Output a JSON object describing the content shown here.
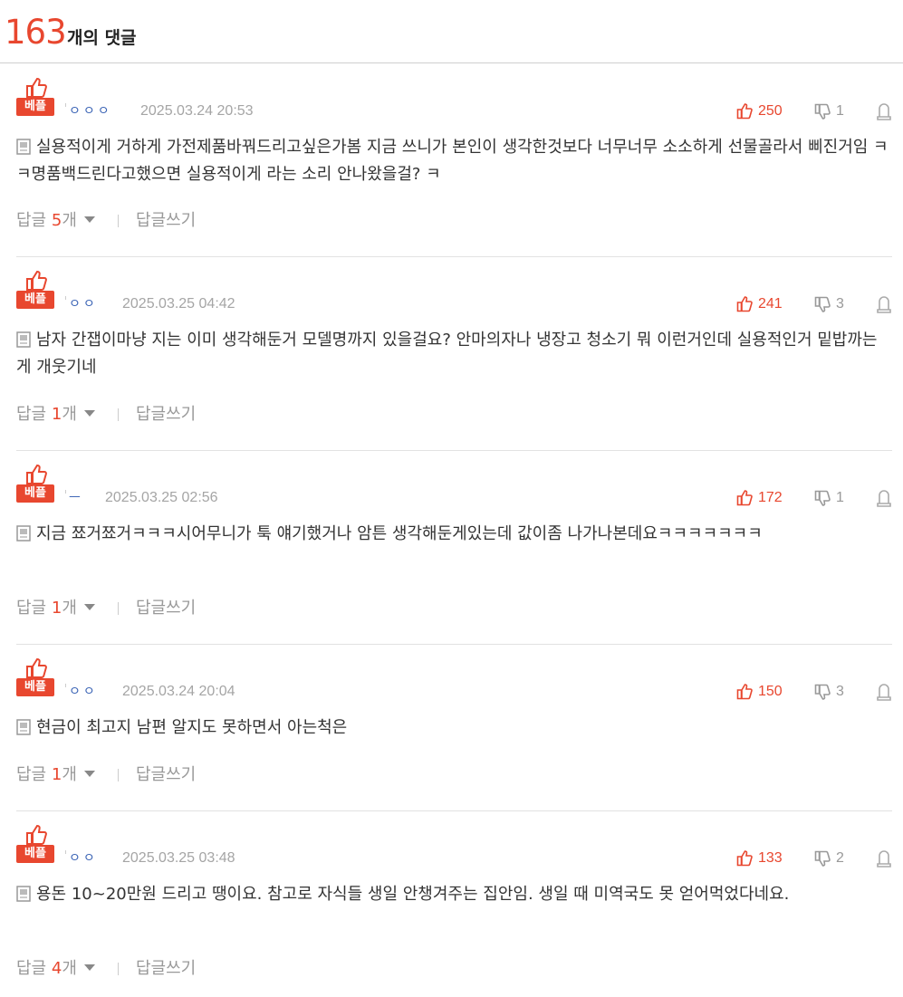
{
  "header": {
    "count": "163",
    "count_label": "개의 댓글"
  },
  "best_label": "베플",
  "comments": [
    {
      "author": "ㅇㅇㅇ",
      "date": "2025.03.24 20:53",
      "likes": "250",
      "dislikes": "1",
      "text": "실용적이게 거하게 가전제품바꿔드리고싶은가봄 지금 쓰니가 본인이 생각한것보다 너무너무 소소하게 선물골라서 삐진거임 ㅋㅋ명품백드린다고했으면 실용적이게 라는 소리 안나왔을걸? ㅋ",
      "reply_label": "답글",
      "reply_count": "5",
      "reply_unit": "개",
      "write_label": "답글쓰기"
    },
    {
      "author": "ㅇㅇ",
      "date": "2025.03.25 04:42",
      "likes": "241",
      "dislikes": "3",
      "text": "남자 간잽이마냥 지는 이미 생각해둔거 모델명까지 있을걸요? 안마의자나 냉장고 청소기 뭐 이런거인데 실용적인거 밑밥까는게 개웃기네",
      "reply_label": "답글",
      "reply_count": "1",
      "reply_unit": "개",
      "write_label": "답글쓰기"
    },
    {
      "author": "ㅡ",
      "date": "2025.03.25 02:56",
      "likes": "172",
      "dislikes": "1",
      "text": "지금 쬬거쬬거ㅋㅋㅋ시어무니가 툭 얘기했거나 암튼 생각해둔게있는데 값이좀 나가나본데요ㅋㅋㅋㅋㅋㅋㅋ",
      "reply_label": "답글",
      "reply_count": "1",
      "reply_unit": "개",
      "write_label": "답글쓰기"
    },
    {
      "author": "ㅇㅇ",
      "date": "2025.03.24 20:04",
      "likes": "150",
      "dislikes": "3",
      "text": "현금이 최고지 남편 알지도 못하면서 아는척은",
      "reply_label": "답글",
      "reply_count": "1",
      "reply_unit": "개",
      "write_label": "답글쓰기"
    },
    {
      "author": "ㅇㅇ",
      "date": "2025.03.25 03:48",
      "likes": "133",
      "dislikes": "2",
      "text": "용돈 10~20만원 드리고 땡이요. 참고로 자식들 생일 안챙겨주는 집안임. 생일 때 미역국도 못 얻어먹었다네요.",
      "reply_label": "답글",
      "reply_count": "4",
      "reply_unit": "개",
      "write_label": "답글쓰기"
    }
  ]
}
